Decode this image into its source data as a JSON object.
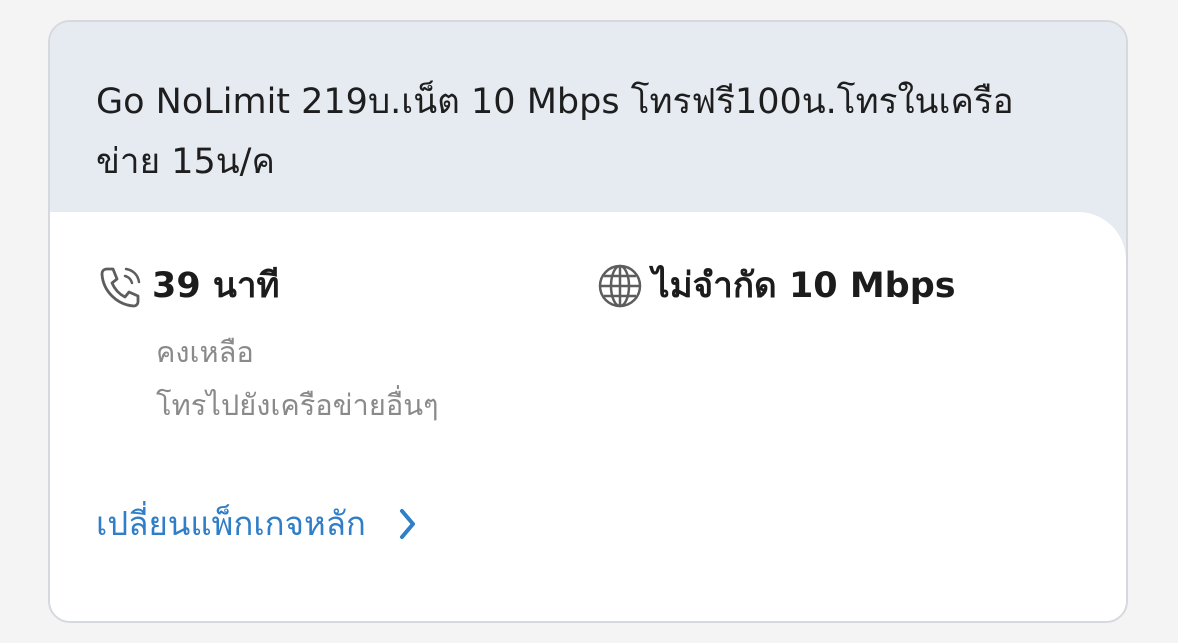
{
  "package": {
    "title": "Go NoLimit 219บ.เน็ต 10 Mbps โทรฟรี100น.โทรในเครือข่าย 15น/ค"
  },
  "voice": {
    "icon": "phone-icon",
    "value": "39 นาที",
    "status": "คงเหลือ",
    "description": "โทรไปยังเครือข่ายอื่นๆ"
  },
  "data": {
    "icon": "globe-icon",
    "value": "ไม่จำกัด 10 Mbps"
  },
  "actions": {
    "change_package_label": "เปลี่ยนแพ็กเกจหลัก",
    "change_package_icon": "chevron-right-icon"
  },
  "colors": {
    "header_background": "#e6ebf2",
    "link": "#2f7ec7",
    "muted_text": "#8a8a8a"
  }
}
